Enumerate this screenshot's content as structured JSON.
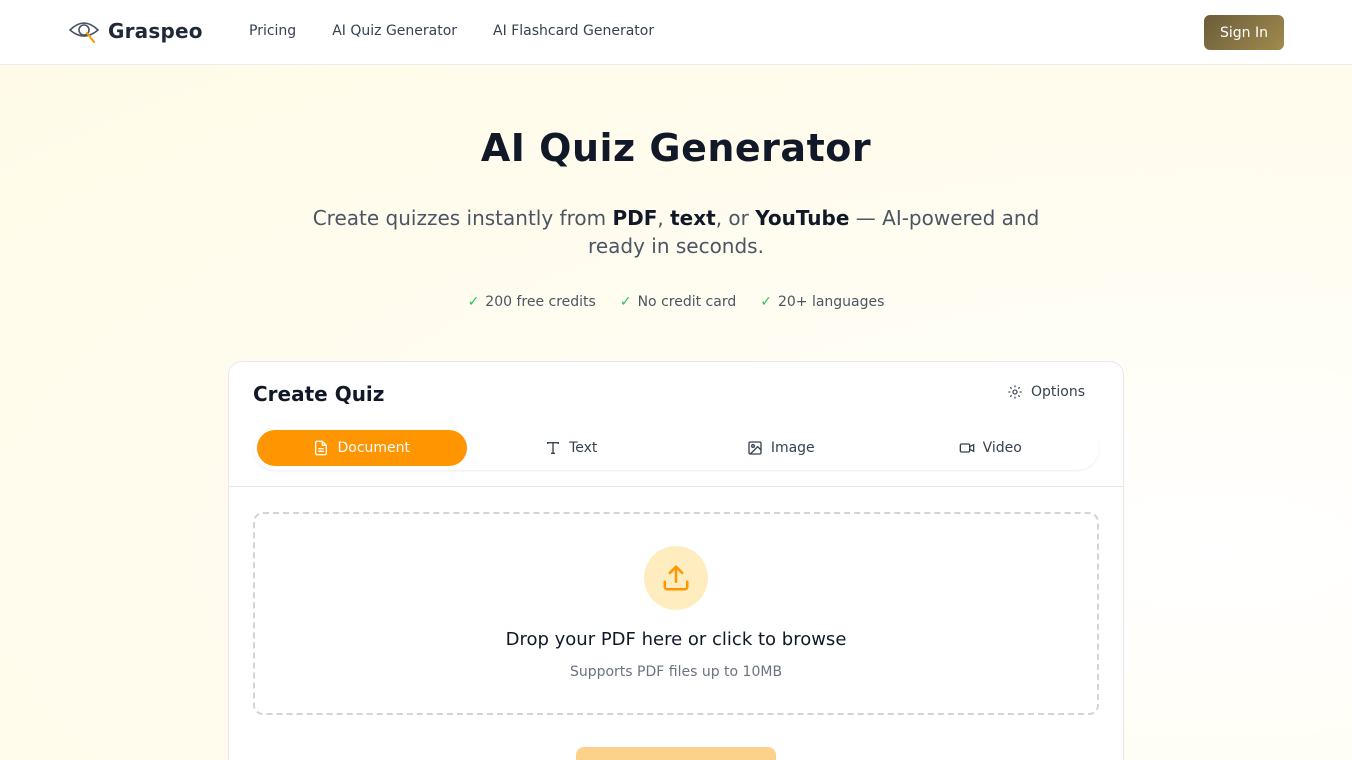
{
  "brand": {
    "name": "Graspeo"
  },
  "nav": {
    "items": [
      {
        "label": "Pricing"
      },
      {
        "label": "AI Quiz Generator"
      },
      {
        "label": "AI Flashcard Generator"
      }
    ],
    "sign_in": "Sign In"
  },
  "hero": {
    "title": "AI Quiz Generator",
    "subtitle": {
      "prefix": "Create quizzes instantly from ",
      "pdf": "PDF",
      "sep1": ", ",
      "text": "text",
      "sep2": ", or ",
      "youtube": "YouTube",
      "suffix": " — AI-powered and ready in seconds."
    },
    "features": [
      {
        "check": "✓",
        "label": "200 free credits"
      },
      {
        "check": "✓",
        "label": "No credit card"
      },
      {
        "check": "✓",
        "label": "20+ languages"
      }
    ]
  },
  "card": {
    "title": "Create Quiz",
    "options_label": "Options",
    "tabs": [
      {
        "label": "Document",
        "icon": "document-icon",
        "active": true
      },
      {
        "label": "Text",
        "icon": "text-icon",
        "active": false
      },
      {
        "label": "Image",
        "icon": "image-icon",
        "active": false
      },
      {
        "label": "Video",
        "icon": "video-icon",
        "active": false
      }
    ],
    "dropzone": {
      "main": "Drop your PDF here or click to browse",
      "sub": "Supports PDF files up to 10MB"
    }
  },
  "colors": {
    "accent": "#ff9500",
    "accent_light": "#ffedbf",
    "check": "#22c55e",
    "signin_gradient_start": "#6b5d3a",
    "signin_gradient_end": "#a08a4d"
  }
}
